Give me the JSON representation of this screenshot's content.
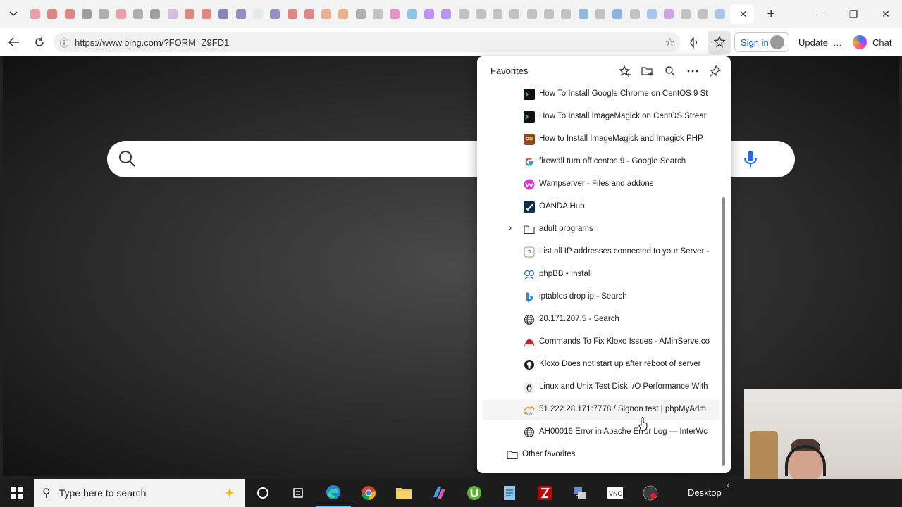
{
  "browser": {
    "address": "https://www.bing.com/?FORM=Z9FD1",
    "sign_in_label": "Sign in",
    "update_label": "Update",
    "more_label": "…",
    "chat_label": "Chat"
  },
  "tabs": {
    "favicon_colors": [
      "#e8556b",
      "#cc2b2b",
      "#cc2b2b",
      "#555555",
      "#777777",
      "#e8556b",
      "#777777",
      "#5a5a5a",
      "#c090d0",
      "#cc2b2b",
      "#cc2b2b",
      "#2b2b8a",
      "#4a3a9a",
      "#cfe8d8",
      "#4a3a9a",
      "#cc2b2b",
      "#cc2b2b",
      "#e07a3a",
      "#e07a3a",
      "#777777",
      "#999999",
      "#e040a0",
      "#3a9ae0",
      "#9146ff",
      "#9146ff",
      "#999999",
      "#999999",
      "#999999",
      "#999999",
      "#999999",
      "#999999",
      "#999999",
      "#3a8ad0",
      "#999999",
      "#3a7ad0",
      "#999999",
      "#6aa0d8",
      "#b060d0",
      "#999999",
      "#999999",
      "#6aa0d8"
    ],
    "close_glyph": "✕",
    "new_tab_glyph": "+"
  },
  "favorites": {
    "title": "Favorites",
    "items": [
      {
        "label": "How To Install Google Chrome on CentOS 9 St",
        "icon": "terminal-icon"
      },
      {
        "label": "How To Install ImageMagick on CentOS Strear",
        "icon": "terminal-icon"
      },
      {
        "label": "How to Install ImageMagick and Imagick PHP",
        "icon": "owl-icon"
      },
      {
        "label": "firewall turn off centos 9 - Google Search",
        "icon": "google-icon"
      },
      {
        "label": "Wampserver - Files and addons",
        "icon": "wamp-icon"
      },
      {
        "label": "OANDA Hub",
        "icon": "oanda-icon"
      },
      {
        "label": "adult programs",
        "icon": "folder-icon",
        "folder": true
      },
      {
        "label": "List all IP addresses connected to your Server -",
        "icon": "question-icon"
      },
      {
        "label": "phpBB • Install",
        "icon": "phpbb-icon"
      },
      {
        "label": "iptables drop ip - Search",
        "icon": "bing-icon"
      },
      {
        "label": "20.171.207.5 - Search",
        "icon": "globe-icon"
      },
      {
        "label": "Commands To Fix Kloxo Issues - AMinServe.co",
        "icon": "aminserve-icon"
      },
      {
        "label": "Kloxo Does not start up after reboot of server",
        "icon": "github-icon"
      },
      {
        "label": "Linux and Unix Test Disk I/O Performance With",
        "icon": "linux-icon"
      },
      {
        "label": "51.222.28.171:7778 / Signon test | phpMyAdm",
        "icon": "phpmyadmin-icon"
      },
      {
        "label": "AH00016 Error in Apache Error Log — InterWc",
        "icon": "globe-icon"
      }
    ],
    "other_favorites_label": "Other favorites"
  },
  "taskbar": {
    "search_placeholder": "Type here to search",
    "desktop_label": "Desktop"
  }
}
